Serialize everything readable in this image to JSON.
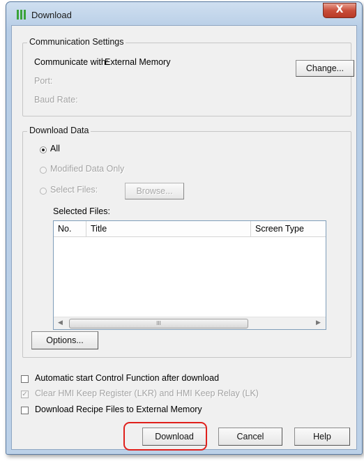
{
  "window": {
    "title": "Download",
    "close_glyph": "X"
  },
  "communication": {
    "legend": "Communication Settings",
    "communicate_label": "Communicate with:",
    "communicate_value": "External Memory",
    "port_label": "Port:",
    "baud_label": "Baud Rate:",
    "change_button": "Change..."
  },
  "download_data": {
    "legend": "Download Data",
    "radio_all": "All",
    "radio_modified": "Modified Data Only",
    "radio_select": "Select Files:",
    "browse_button": "Browse...",
    "selected_files_label": "Selected Files:",
    "columns": [
      "No.",
      "Title",
      "Screen Type"
    ],
    "scroll_thumb_glyph": "III",
    "options_button": "Options..."
  },
  "options": {
    "auto_start": "Automatic start Control Function after download",
    "clear_keep": "Clear HMI Keep Register (LKR) and HMI Keep Relay (LK)",
    "clear_keep_checked": true,
    "recipe": "Download Recipe Files to External Memory"
  },
  "buttons": {
    "download": "Download",
    "cancel": "Cancel",
    "help": "Help"
  },
  "colors": {
    "highlight": "#e0201c",
    "window_frame": "#b7cde6",
    "close": "#c94e3a"
  }
}
